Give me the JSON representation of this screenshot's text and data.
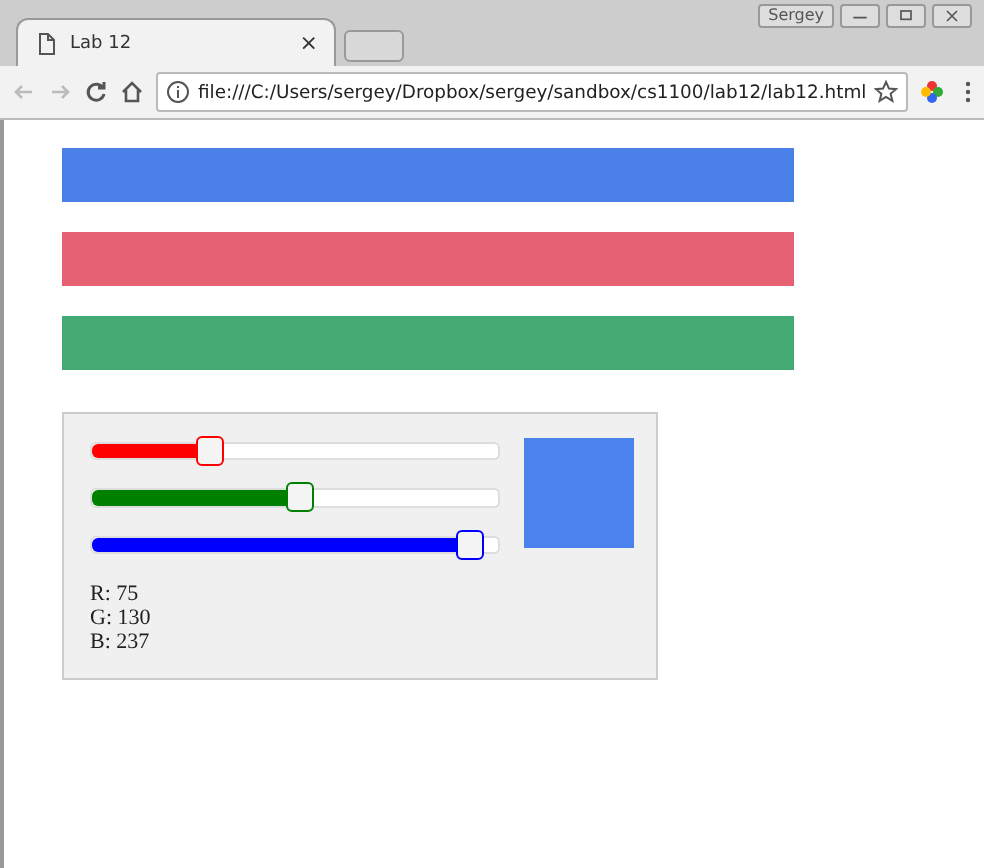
{
  "window": {
    "user": "Sergey"
  },
  "tabs": [
    {
      "title": "Lab 12",
      "close": "×",
      "selected": true
    }
  ],
  "address_bar": {
    "url": "file:///C:/Users/sergey/Dropbox/sergey/sandbox/cs1100/lab12/lab12.html"
  },
  "color_bars": [
    {
      "color": "#4a80e8"
    },
    {
      "color": "#e66173"
    },
    {
      "color": "#44aa73"
    }
  ],
  "mixer": {
    "sliders": [
      {
        "color": "#ff0000",
        "level": 0.29
      },
      {
        "color": "#008000",
        "level": 0.51
      },
      {
        "color": "#0000ff",
        "level": 0.93
      }
    ],
    "swatch": {
      "color": "#4b82ed"
    },
    "readings": [
      "R: 75",
      "G: 130",
      "B: 237"
    ]
  }
}
